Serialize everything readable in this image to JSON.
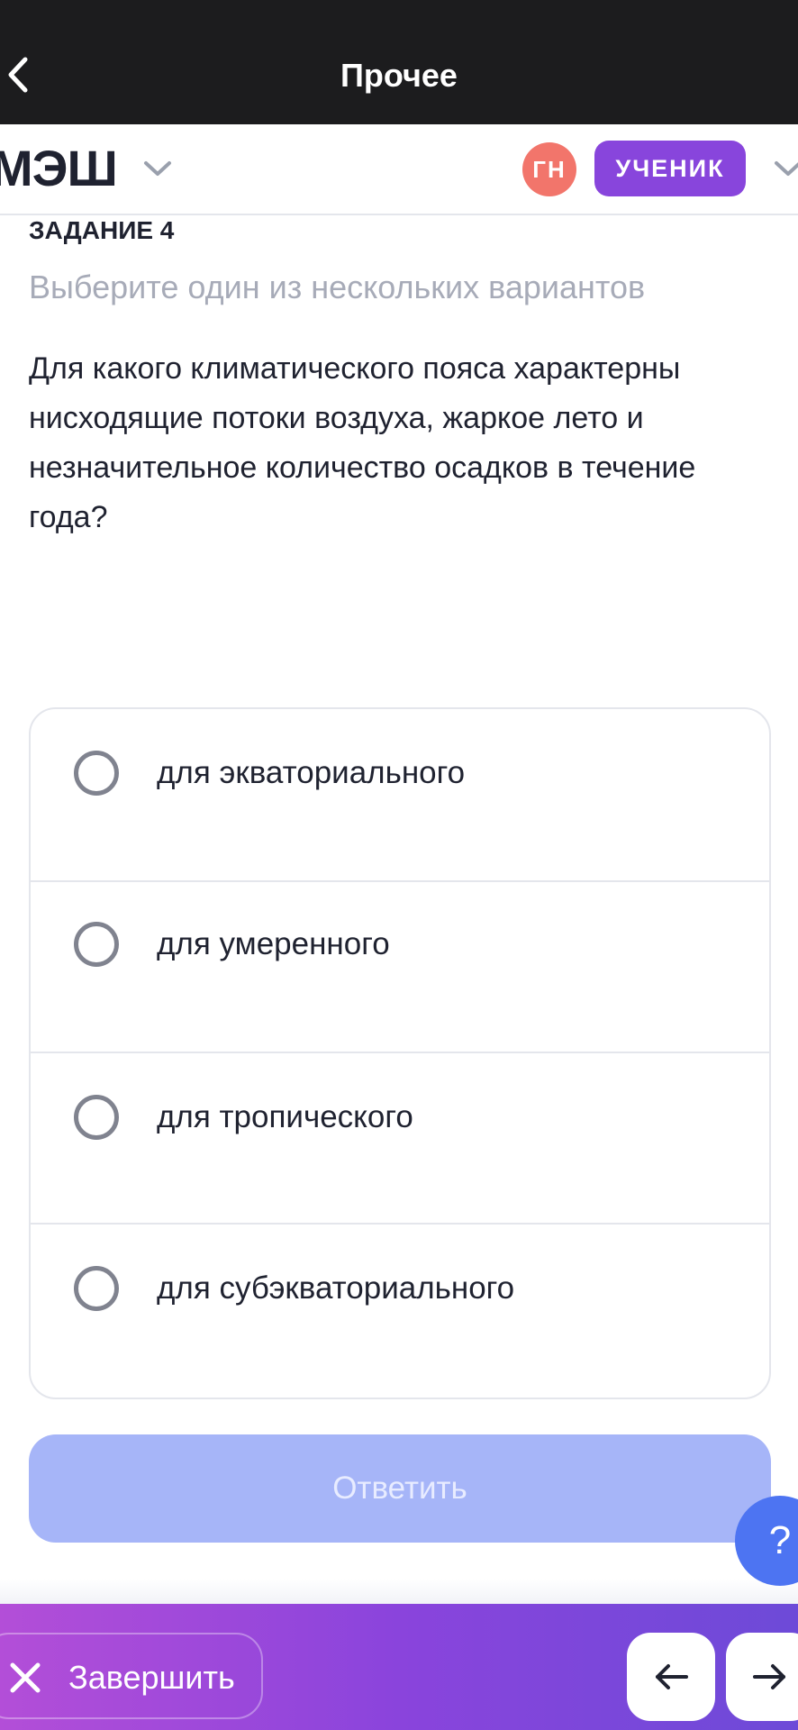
{
  "topbar": {
    "title": "Прочее",
    "back_icon": "chevron-left-icon"
  },
  "appbar": {
    "logo_text": "МЭШ",
    "avatar_initials": "ГН",
    "avatar_color": "#f2756b",
    "role_label": "УЧЕНИК",
    "role_color": "#8845dc"
  },
  "task": {
    "label": "ЗАДАНИЕ 4",
    "hint": "Выберите один из нескольких вариантов",
    "question": "Для какого климатического пояса характерны нисходящие потоки воздуха, жаркое лето и незначительное количество осадков в течение года?"
  },
  "options": [
    {
      "label": "для экваториального",
      "selected": false
    },
    {
      "label": "для умеренного",
      "selected": false
    },
    {
      "label": "для тропического",
      "selected": false
    },
    {
      "label": "для субэкваториального",
      "selected": false
    }
  ],
  "answer_button": {
    "label": "Ответить",
    "enabled": false,
    "color": "#a6b5f8"
  },
  "help_button": {
    "label": "?",
    "color": "#4d74f2"
  },
  "bottombar": {
    "finish_label": "Завершить",
    "finish_icon": "close-icon",
    "prev_icon": "arrow-left-icon",
    "next_icon": "arrow-right-icon"
  }
}
